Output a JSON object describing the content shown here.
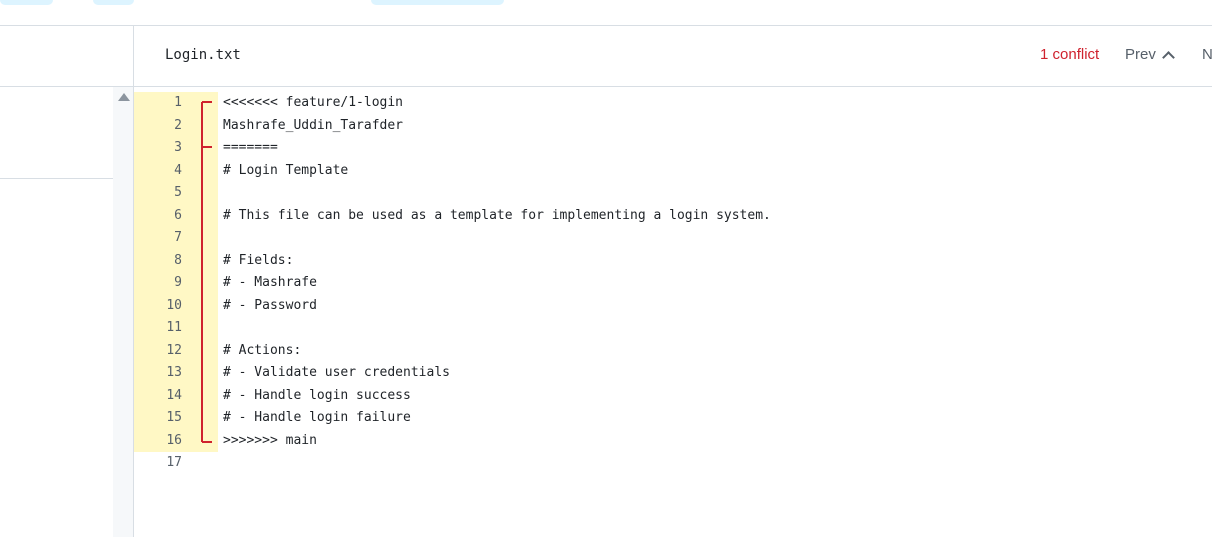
{
  "colors": {
    "conflict_accent": "#cf222e",
    "conflict_bg": "#fff8c5",
    "tab_bg": "#ddf4ff",
    "border": "#d8dee4"
  },
  "file": {
    "name": "Login.txt",
    "conflict_count_label": "1 conflict",
    "prev_label": "Prev",
    "next_label": "N"
  },
  "lines": [
    {
      "n": "1",
      "text": "<<<<<<< feature/1-login"
    },
    {
      "n": "2",
      "text": "Mashrafe_Uddin_Tarafder"
    },
    {
      "n": "3",
      "text": "======="
    },
    {
      "n": "4",
      "text": "# Login Template"
    },
    {
      "n": "5",
      "text": ""
    },
    {
      "n": "6",
      "text": "# This file can be used as a template for implementing a login system."
    },
    {
      "n": "7",
      "text": ""
    },
    {
      "n": "8",
      "text": "# Fields:"
    },
    {
      "n": "9",
      "text": "# - Mashrafe"
    },
    {
      "n": "10",
      "text": "# - Password"
    },
    {
      "n": "11",
      "text": ""
    },
    {
      "n": "12",
      "text": "# Actions:"
    },
    {
      "n": "13",
      "text": "# - Validate user credentials"
    },
    {
      "n": "14",
      "text": "# - Handle login success"
    },
    {
      "n": "15",
      "text": "# - Handle login failure"
    },
    {
      "n": "16",
      "text": ">>>>>>> main"
    },
    {
      "n": "17",
      "text": ""
    }
  ]
}
